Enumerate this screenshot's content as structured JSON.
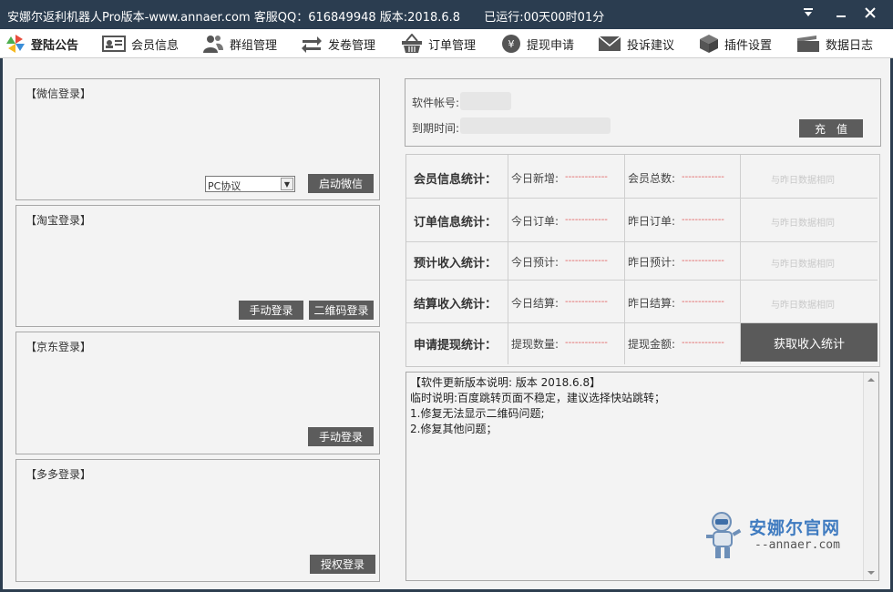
{
  "window": {
    "title": "安娜尔返利机器人Pro版本-www.annaer.com 客服QQ：616849948  版本:2018.6.8",
    "runtime": "已运行:00天00时01分"
  },
  "menu": [
    {
      "label": "登陆公告",
      "icon": "pinwheel-icon"
    },
    {
      "label": "会员信息",
      "icon": "id-card-icon"
    },
    {
      "label": "群组管理",
      "icon": "users-icon"
    },
    {
      "label": "发卷管理",
      "icon": "transfer-arrows-icon"
    },
    {
      "label": "订单管理",
      "icon": "basket-icon"
    },
    {
      "label": "提现申请",
      "icon": "yen-coin-icon"
    },
    {
      "label": "投诉建议",
      "icon": "mail-icon"
    },
    {
      "label": "插件设置",
      "icon": "cube-icon"
    },
    {
      "label": "数据日志",
      "icon": "folder-icon"
    }
  ],
  "wechat": {
    "title": "【微信登录】",
    "protocol": "PC协议",
    "start_btn": "启动微信"
  },
  "taobao": {
    "title": "【淘宝登录】",
    "manual_btn": "手动登录",
    "qr_btn": "二维码登录"
  },
  "jd": {
    "title": "【京东登录】",
    "manual_btn": "手动登录"
  },
  "pdd": {
    "title": "【多多登录】",
    "auth_btn": "授权登录"
  },
  "account": {
    "account_label": "软件帐号:",
    "expire_label": "到期时间:",
    "recharge_btn": "充　值"
  },
  "stats": [
    {
      "label": "会员信息统计：",
      "k1": "今日新增:",
      "v1": "-------------",
      "k2": "会员总数:",
      "v2": "-------------",
      "note": "与昨日数据相同"
    },
    {
      "label": "订单信息统计：",
      "k1": "今日订单:",
      "v1": "-------------",
      "k2": "昨日订单:",
      "v2": "-------------",
      "note": "与昨日数据相同"
    },
    {
      "label": "预计收入统计：",
      "k1": "今日预计:",
      "v1": "-------------",
      "k2": "昨日预计:",
      "v2": "-------------",
      "note": "与昨日数据相同"
    },
    {
      "label": "结算收入统计：",
      "k1": "今日结算:",
      "v1": "-------------",
      "k2": "昨日结算:",
      "v2": "-------------",
      "note": "与昨日数据相同"
    },
    {
      "label": "申请提现统计：",
      "k1": "提现数量:",
      "v1": "-------------",
      "k2": "提现金额:",
      "v2": "-------------",
      "button": "获取收入统计"
    }
  ],
  "notes": {
    "lines": [
      "【软件更新版本说明: 版本 2018.6.8】",
      "临时说明:百度跳转页面不稳定，建议选择快站跳转；",
      "1.修复无法显示二维码问题;",
      "2.修复其他问题；"
    ]
  },
  "watermark": {
    "brand": "安娜尔官网",
    "url": "--annaer.com"
  }
}
